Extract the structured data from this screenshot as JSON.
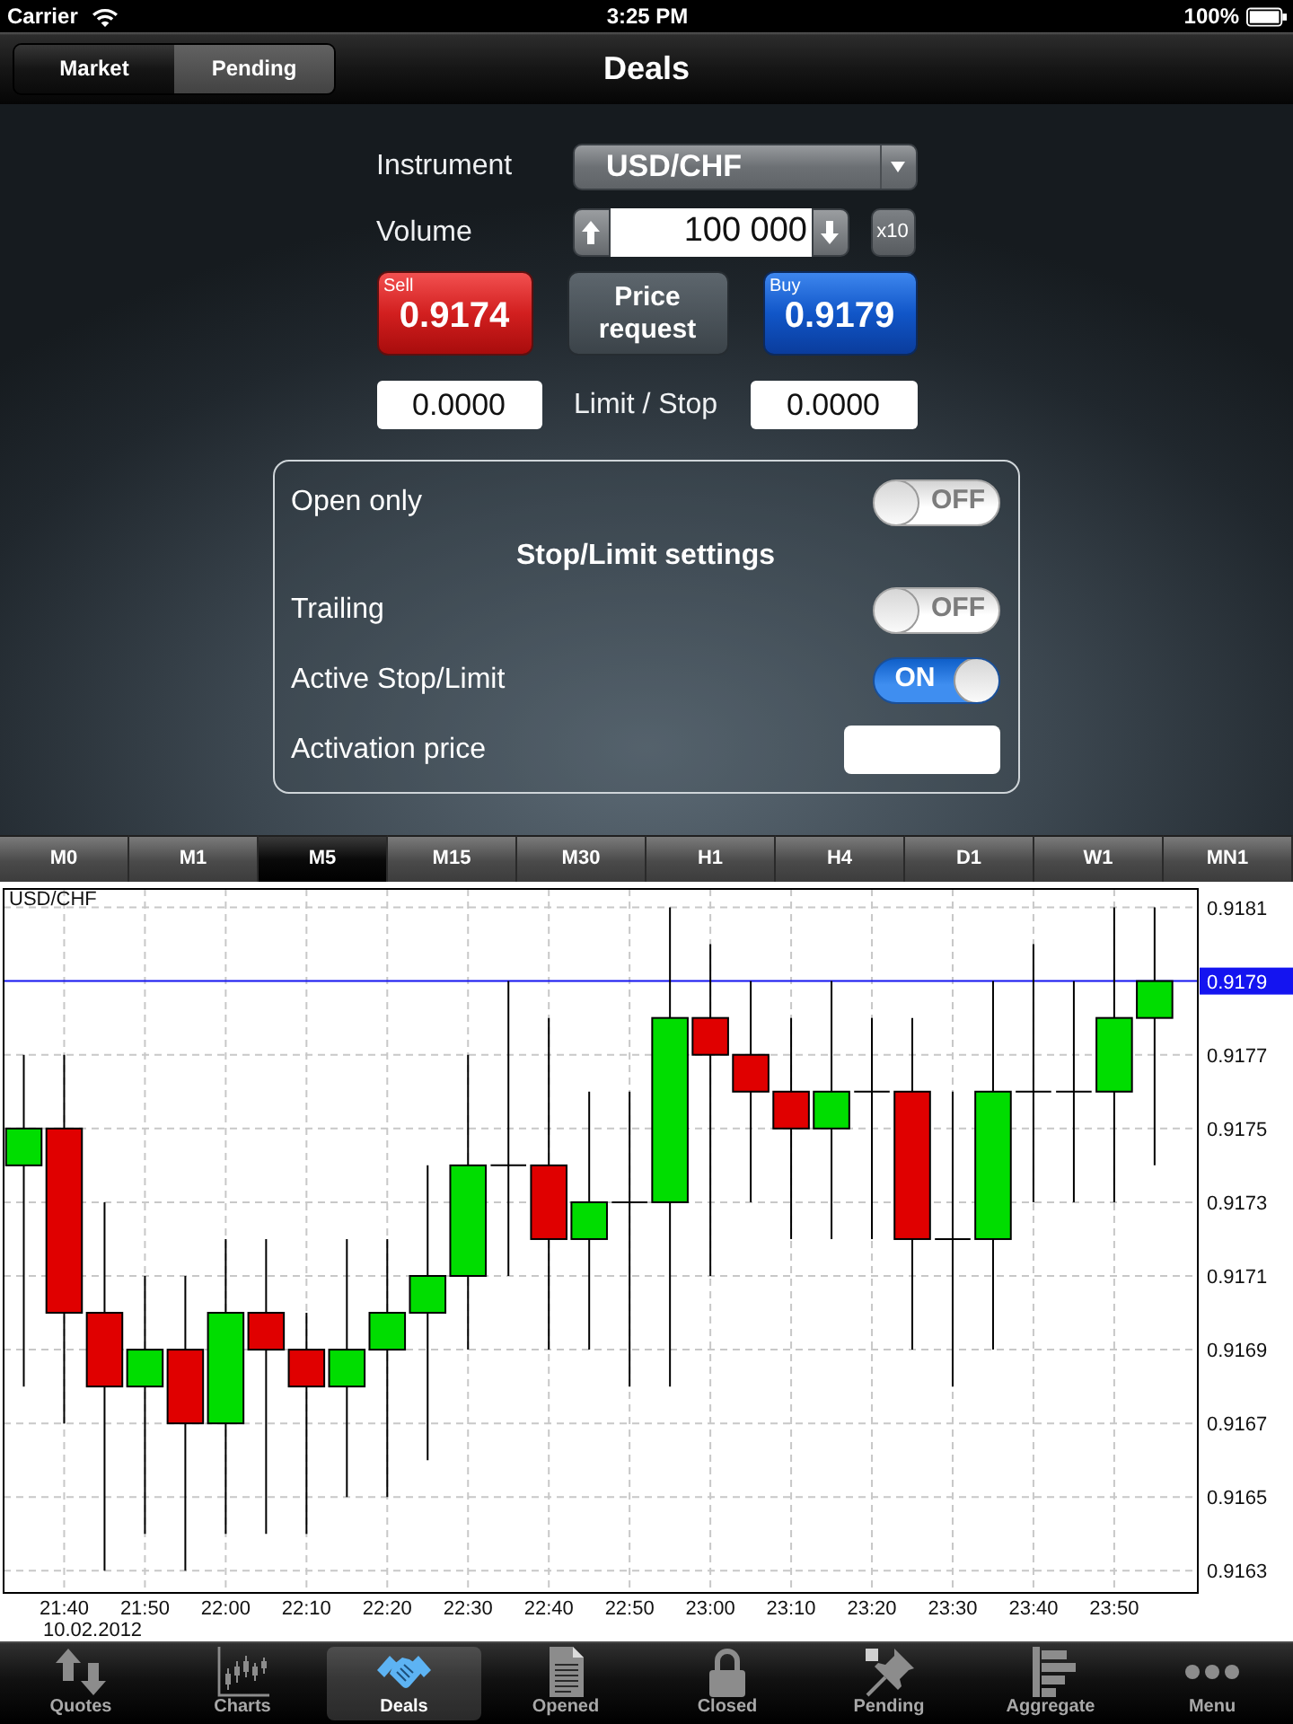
{
  "status_bar": {
    "carrier": "Carrier",
    "time": "3:25 PM",
    "battery": "100%"
  },
  "nav_bar": {
    "segments": [
      {
        "label": "Market",
        "selected": true
      },
      {
        "label": "Pending",
        "selected": false
      }
    ],
    "title": "Deals"
  },
  "order_form": {
    "instrument": {
      "label": "Instrument",
      "value": "USD/CHF"
    },
    "volume": {
      "label": "Volume",
      "value": "100 000",
      "multiplier": "x10"
    },
    "quote_buttons": [
      {
        "kind": "sell",
        "caption": "Sell",
        "price": "0.9174"
      },
      {
        "kind": "request",
        "caption": "Price request"
      },
      {
        "kind": "buy",
        "caption": "Buy",
        "price": "0.9179"
      }
    ],
    "limit_stop": {
      "label": "Limit / Stop",
      "values": [
        "0.0000",
        "0.0000"
      ]
    }
  },
  "settings": {
    "rows": [
      {
        "kind": "switch",
        "label": "Open only",
        "on": false,
        "switch_text": "OFF"
      },
      {
        "kind": "header",
        "label": "Stop/Limit settings"
      },
      {
        "kind": "switch",
        "label": "Trailing",
        "on": false,
        "switch_text": "OFF"
      },
      {
        "kind": "switch",
        "label": "Active Stop/Limit",
        "on": true,
        "switch_text": "ON"
      },
      {
        "kind": "field",
        "label": "Activation price"
      }
    ]
  },
  "timeframes": [
    {
      "label": "M0",
      "selected": false
    },
    {
      "label": "M1",
      "selected": false
    },
    {
      "label": "M5",
      "selected": true
    },
    {
      "label": "M15",
      "selected": false
    },
    {
      "label": "M30",
      "selected": false
    },
    {
      "label": "H1",
      "selected": false
    },
    {
      "label": "H4",
      "selected": false
    },
    {
      "label": "D1",
      "selected": false
    },
    {
      "label": "W1",
      "selected": false
    },
    {
      "label": "MN1",
      "selected": false
    }
  ],
  "chart": {
    "chart_data": {
      "type": "candlestick",
      "title": "USD/CHF",
      "categories": [
        null,
        "21:40",
        null,
        "21:50",
        null,
        "22:00",
        null,
        "22:10",
        null,
        "22:20",
        null,
        "22:30",
        null,
        "22:40",
        null,
        "22:50",
        null,
        "23:00",
        null,
        "23:10",
        null,
        "23:20",
        null,
        "23:30",
        null,
        "23:40",
        null,
        "23:50",
        null
      ],
      "ohlc": [
        [
          0.9174,
          0.9177,
          0.9168,
          0.9175
        ],
        [
          0.9175,
          0.9177,
          0.9167,
          0.917
        ],
        [
          0.917,
          0.9173,
          0.9163,
          0.9168
        ],
        [
          0.9168,
          0.9171,
          0.9164,
          0.9169
        ],
        [
          0.9169,
          0.9171,
          0.9163,
          0.9167
        ],
        [
          0.9167,
          0.9172,
          0.9164,
          0.917
        ],
        [
          0.917,
          0.9172,
          0.9164,
          0.9169
        ],
        [
          0.9169,
          0.917,
          0.9164,
          0.9168
        ],
        [
          0.9168,
          0.9172,
          0.9165,
          0.9169
        ],
        [
          0.9169,
          0.9172,
          0.9165,
          0.917
        ],
        [
          0.917,
          0.9174,
          0.9166,
          0.9171
        ],
        [
          0.9171,
          0.9177,
          0.9169,
          0.9174
        ],
        [
          0.9174,
          0.9179,
          0.9171,
          0.9174
        ],
        [
          0.9174,
          0.9178,
          0.9169,
          0.9172
        ],
        [
          0.9172,
          0.9176,
          0.9169,
          0.9173
        ],
        [
          0.9173,
          0.9176,
          0.9168,
          0.9173
        ],
        [
          0.9173,
          0.9181,
          0.9168,
          0.9178
        ],
        [
          0.9178,
          0.918,
          0.9171,
          0.9177
        ],
        [
          0.9177,
          0.9179,
          0.9173,
          0.9176
        ],
        [
          0.9176,
          0.9178,
          0.9172,
          0.9175
        ],
        [
          0.9175,
          0.9179,
          0.9172,
          0.9176
        ],
        [
          0.9176,
          0.9178,
          0.9172,
          0.9176
        ],
        [
          0.9176,
          0.9178,
          0.9169,
          0.9172
        ],
        [
          0.9172,
          0.9176,
          0.9168,
          0.9172
        ],
        [
          0.9172,
          0.9179,
          0.9169,
          0.9176
        ],
        [
          0.9176,
          0.918,
          0.9173,
          0.9176
        ],
        [
          0.9176,
          0.9179,
          0.9173,
          0.9176
        ],
        [
          0.9176,
          0.9181,
          0.9173,
          0.9178
        ],
        [
          0.9178,
          0.9181,
          0.9174,
          0.9179
        ]
      ],
      "ylim": [
        0.91624,
        0.91815
      ],
      "yticks": [
        0.9163,
        0.9165,
        0.9167,
        0.9169,
        0.9171,
        0.9173,
        0.9175,
        0.9177,
        0.9181
      ],
      "grid": true,
      "ref_lines": [
        {
          "axis": "y",
          "value": 0.9179,
          "label": "0.9179",
          "color": "#1414f0"
        }
      ]
    },
    "date_label": "10.02.2012"
  },
  "tab_bar": [
    {
      "label": "Quotes",
      "selected": false
    },
    {
      "label": "Charts",
      "selected": false
    },
    {
      "label": "Deals",
      "selected": true
    },
    {
      "label": "Opened",
      "selected": false
    },
    {
      "label": "Closed",
      "selected": false
    },
    {
      "label": "Pending",
      "selected": false
    },
    {
      "label": "Aggregate",
      "selected": false
    },
    {
      "label": "Menu",
      "selected": false
    }
  ]
}
